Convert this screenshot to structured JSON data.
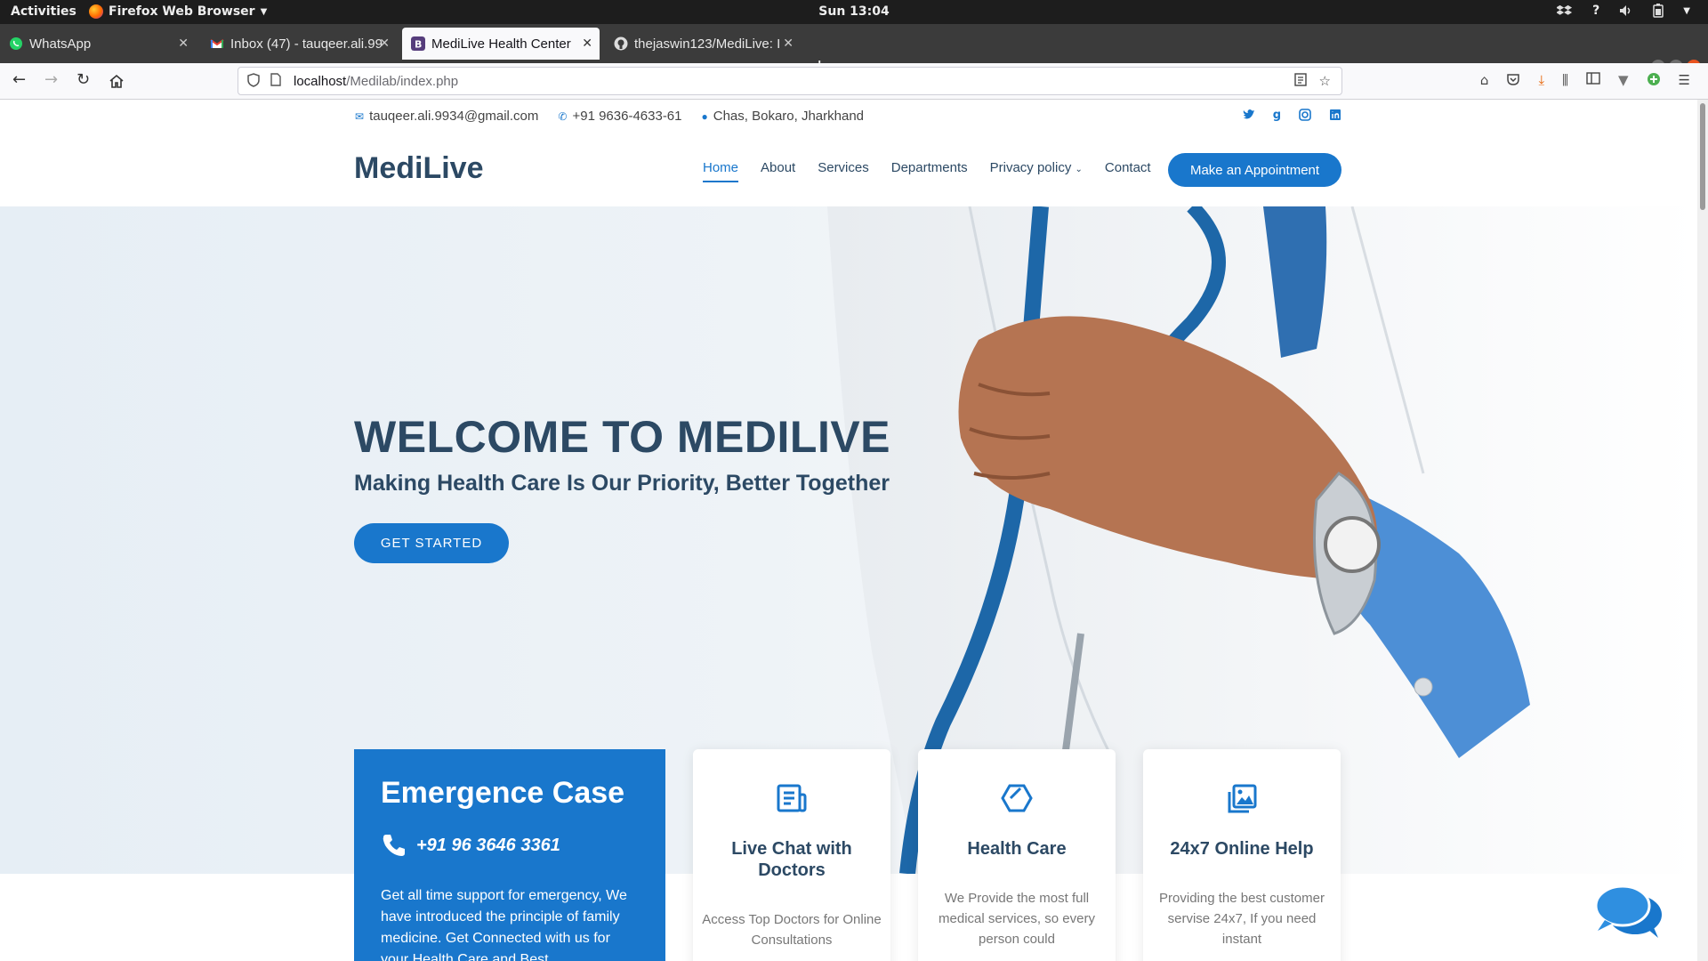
{
  "system_bar": {
    "activities": "Activities",
    "app_name": "Firefox Web Browser",
    "clock": "Sun 13:04",
    "tray_icons": [
      "dropbox-icon",
      "help-icon",
      "volume-icon",
      "battery-icon",
      "power-menu-icon"
    ],
    "tray_help": "?"
  },
  "tabs": [
    {
      "label": "WhatsApp",
      "favicon": "whatsapp-icon",
      "color": "#25d366",
      "active": false
    },
    {
      "label": "Inbox (47) - tauqeer.ali.99",
      "favicon": "gmail-icon",
      "color": "#ea4335",
      "active": false
    },
    {
      "label": "MediLive Health Center",
      "favicon": "bootstrap-icon",
      "color": "#563d7c",
      "active": true
    },
    {
      "label": "thejaswin123/MediLive: I",
      "favicon": "github-icon",
      "color": "#24292e",
      "active": false
    }
  ],
  "address_bar": {
    "host": "localhost",
    "path": "/Medilab/index.php"
  },
  "site": {
    "contact": {
      "email": "tauqeer.ali.9934@gmail.com",
      "phone": "+91 9636-4633-61",
      "location": "Chas, Bokaro, Jharkhand"
    },
    "social": [
      "twitter-icon",
      "google-icon",
      "instagram-icon",
      "linkedin-icon"
    ],
    "social_google_glyph": "g",
    "brand": "MediLive",
    "menu": {
      "home": "Home",
      "about": "About",
      "services": "Services",
      "departments": "Departments",
      "privacy": "Privacy policy",
      "contact": "Contact"
    },
    "appointment_button": "Make an Appointment",
    "hero": {
      "title": "WELCOME TO MEDILIVE",
      "subtitle": "Making Health Care Is Our Priority, Better Together",
      "cta": "GET STARTED"
    },
    "emergency": {
      "title": "Emergence Case",
      "phone": "+91 96 3646 3361",
      "text": "Get all time support for emergency, We have introduced the principle of family medicine. Get Connected with us for your Health Care and Best"
    },
    "cards": [
      {
        "icon": "document-icon",
        "title": "Live Chat with Doctors",
        "text": "Access Top Doctors for Online Consultations"
      },
      {
        "icon": "hexagon-icon",
        "title": "Health Care",
        "text": "We Provide the most full medical services, so every person could"
      },
      {
        "icon": "image-gallery-icon",
        "title": "24x7 Online Help",
        "text": "Providing the best customer servise 24x7, If you need instant"
      }
    ]
  },
  "colors": {
    "accent": "#1977cc",
    "heading": "#2c4964",
    "gnome_bar": "#1d1d1d",
    "tab_strip": "#3b3b3b"
  }
}
